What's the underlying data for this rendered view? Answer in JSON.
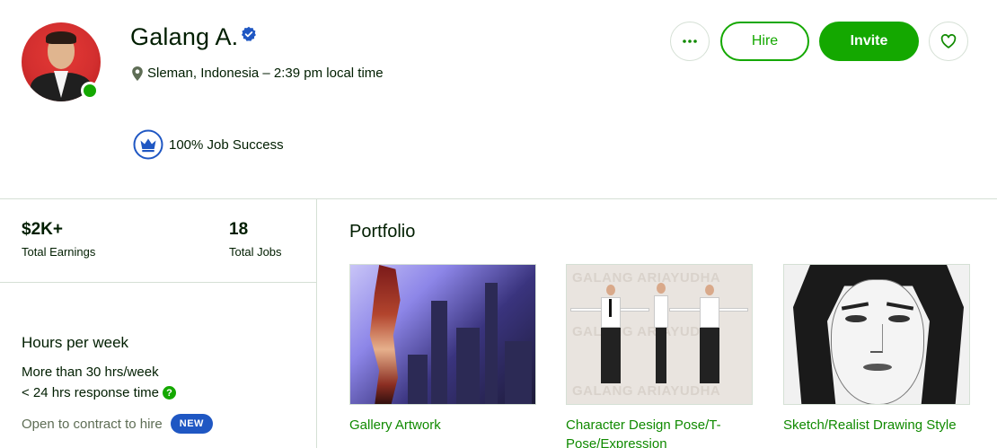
{
  "profile": {
    "name": "Galang A.",
    "location": "Sleman, Indonesia – 2:39 pm local time",
    "job_success": "100% Job Success"
  },
  "actions": {
    "more_label": "•••",
    "hire_label": "Hire",
    "invite_label": "Invite"
  },
  "stats": [
    {
      "value": "$2K+",
      "label": "Total Earnings"
    },
    {
      "value": "18",
      "label": "Total Jobs"
    }
  ],
  "availability": {
    "title": "Hours per week",
    "hours": "More than 30 hrs/week",
    "response": "< 24 hrs response time",
    "contract": "Open to contract to hire",
    "new_badge": "NEW"
  },
  "portfolio": {
    "title": "Portfolio",
    "items": [
      {
        "title": "Gallery Artwork"
      },
      {
        "title": "Character Design Pose/T-Pose/Expression",
        "watermark": "GALANG ARIAYUDHA"
      },
      {
        "title": "Sketch/Realist Drawing Style"
      }
    ]
  },
  "colors": {
    "accent": "#14a800",
    "link": "#108a00",
    "badge_blue": "#1f57c3"
  },
  "icons": [
    "verified-icon",
    "map-pin-icon",
    "more-icon",
    "heart-icon",
    "crown-icon",
    "help-icon"
  ]
}
